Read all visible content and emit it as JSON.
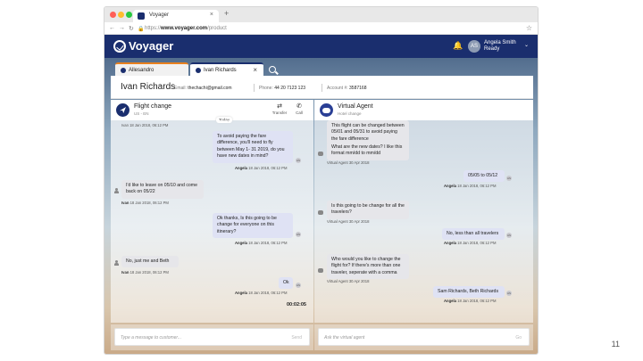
{
  "slide": {
    "page_number": "11"
  },
  "browser": {
    "tab_title": "Voyager",
    "url_prefix": "https://",
    "url_host": "www.voyager.com",
    "url_path": "/product",
    "colors": {
      "red": "#ff5f57",
      "yellow": "#febc2e",
      "green": "#28c840"
    }
  },
  "app": {
    "brand": "Voyager",
    "user": {
      "initials": "AS",
      "name": "Angela Smith",
      "status": "Ready"
    },
    "session_tabs": [
      {
        "label": "Allesandro",
        "dot_color": "#1a2e6e"
      },
      {
        "label": "Ivan Richards",
        "dot_color": "#1a2e6e"
      }
    ],
    "customer": {
      "name": "Ivan Richards",
      "email_label": "Email:",
      "email": "thechachi@gmail.com",
      "phone_label": "Phone:",
      "phone": "44 20 7123 123",
      "account_label": "Account #:",
      "account": "3587168"
    },
    "left": {
      "title": "Flight change",
      "subtitle": "US - EN",
      "actions": {
        "transfer": "Transfer",
        "call": "Call"
      },
      "today": "Today",
      "first_meta": "Ivan 18 Jan 2018, 06:12 PM",
      "messages": [
        {
          "text": "To avoid paying the fare difference, you'll need to fly between May 1- 31 2019, do you have new dates in mind?",
          "meta_name": "Angela",
          "meta_time": "18 Jan 2018, 06:12 PM",
          "avatar": "AS"
        },
        {
          "text": "I'd like to leave on 05/10 and come back on 05/22",
          "meta_name": "Ivan",
          "meta_time": "18 Jan 2018, 06:12 PM"
        },
        {
          "text": "Ok thanks, Is this going to be change for everyone on this itinerary?",
          "meta_name": "Angela",
          "meta_time": "18 Jan 2018, 06:12 PM",
          "avatar": "AS"
        },
        {
          "text": "No, just me and Beth",
          "meta_name": "Ivan",
          "meta_time": "18 Jan 2018, 06:12 PM"
        },
        {
          "text": "Ok",
          "meta_name": "Angela",
          "meta_time": "18 Jan 2018, 06:12 PM",
          "avatar": "AS"
        }
      ],
      "timer": "00:02:05",
      "composer_placeholder": "Type a message to customer...",
      "send": "Send"
    },
    "right": {
      "title": "Virtual Agent",
      "subtitle": "Hotel change",
      "messages": [
        {
          "text": "This flight can be changed between 05/01 and 05/31 to avoid paying the fare difference"
        },
        {
          "text": "What are the new dates? I like this format mm/dd to mm/dd",
          "meta": "Virtual Agent 30 Apr 2018"
        },
        {
          "text": "05/05 to 05/12",
          "meta_name": "Angela",
          "meta_time": "18 Jan 2018, 06:12 PM",
          "avatar": "AS"
        },
        {
          "text": "Is this going to be change for all the travelers?",
          "meta": "Virtual Agent 30 Apr 2018"
        },
        {
          "text": "No, less than all travelers",
          "meta_name": "Angela",
          "meta_time": "18 Jan 2018, 06:12 PM",
          "avatar": "AS"
        },
        {
          "text": "Who would you like to change the flight for? If there's more than one traveler, seperate with a comma",
          "meta": "Virtual Agent 30 Apr 2018"
        },
        {
          "text": "Sam Richards, Beth Richards",
          "meta_name": "Angela",
          "meta_time": "18 Jan 2018, 06:12 PM",
          "avatar": "AS"
        }
      ],
      "composer_placeholder": "Ask the virtual agent",
      "send": "Go"
    }
  }
}
